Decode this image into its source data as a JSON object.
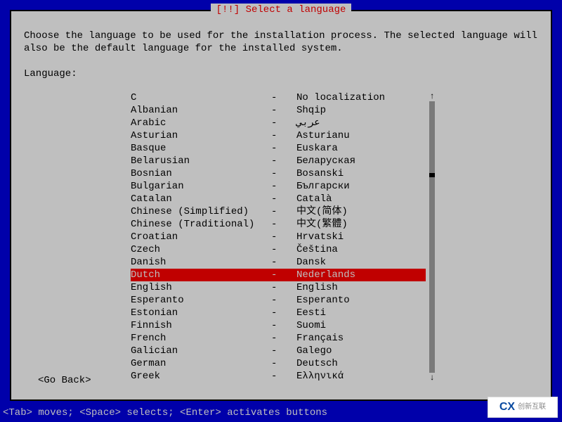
{
  "title": "[!!] Select a language",
  "instruction": "Choose the language to be used for the installation process. The selected language will also be the default language for the installed system.",
  "field_label": "Language:",
  "selected_index": 14,
  "languages": [
    {
      "english": "C",
      "native": "No localization"
    },
    {
      "english": "Albanian",
      "native": "Shqip"
    },
    {
      "english": "Arabic",
      "native": "عربي"
    },
    {
      "english": "Asturian",
      "native": "Asturianu"
    },
    {
      "english": "Basque",
      "native": "Euskara"
    },
    {
      "english": "Belarusian",
      "native": "Беларуская"
    },
    {
      "english": "Bosnian",
      "native": "Bosanski"
    },
    {
      "english": "Bulgarian",
      "native": "Български"
    },
    {
      "english": "Catalan",
      "native": "Català"
    },
    {
      "english": "Chinese (Simplified)",
      "native": "中文(简体)"
    },
    {
      "english": "Chinese (Traditional)",
      "native": "中文(繁體)"
    },
    {
      "english": "Croatian",
      "native": "Hrvatski"
    },
    {
      "english": "Czech",
      "native": "Čeština"
    },
    {
      "english": "Danish",
      "native": "Dansk"
    },
    {
      "english": "Dutch",
      "native": "Nederlands"
    },
    {
      "english": "English",
      "native": "English"
    },
    {
      "english": "Esperanto",
      "native": "Esperanto"
    },
    {
      "english": "Estonian",
      "native": "Eesti"
    },
    {
      "english": "Finnish",
      "native": "Suomi"
    },
    {
      "english": "French",
      "native": "Français"
    },
    {
      "english": "Galician",
      "native": "Galego"
    },
    {
      "english": "German",
      "native": "Deutsch"
    },
    {
      "english": "Greek",
      "native": "Ελληνικά"
    }
  ],
  "go_back_label": "<Go Back>",
  "footer": "<Tab> moves; <Space> selects; <Enter> activates buttons",
  "scroll": {
    "up": "↑",
    "down": "↓"
  },
  "watermark": {
    "logo": "CX",
    "text": "创新互联"
  }
}
